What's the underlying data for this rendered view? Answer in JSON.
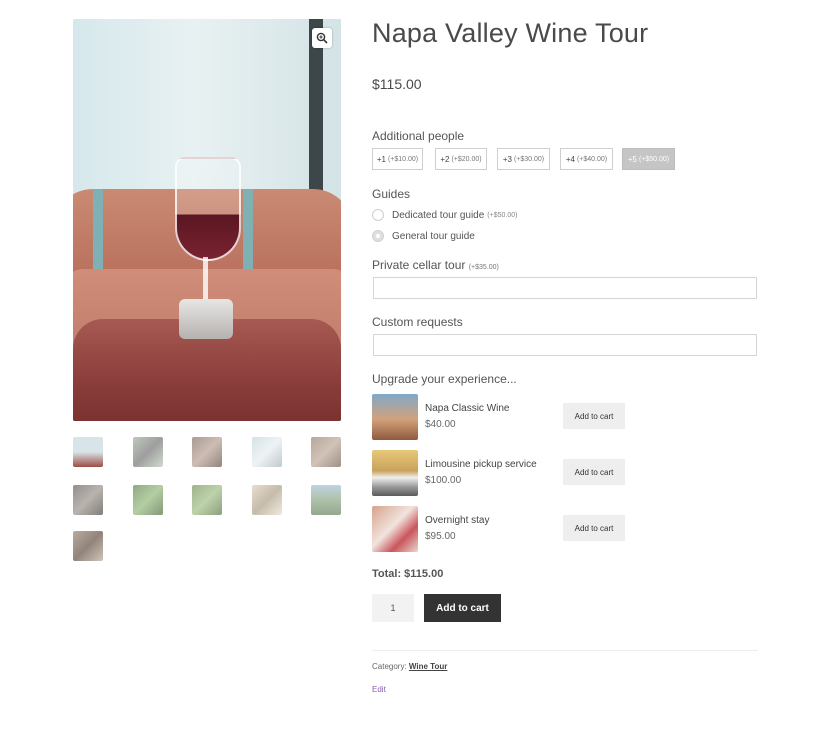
{
  "product": {
    "title": "Napa Valley Wine Tour",
    "price": "$115.00"
  },
  "additional_people": {
    "label": "Additional people",
    "options": [
      {
        "label": "+1",
        "extra": "(+$10.00)",
        "selected": false
      },
      {
        "label": "+2",
        "extra": "(+$20.00)",
        "selected": false
      },
      {
        "label": "+3",
        "extra": "(+$30.00)",
        "selected": false
      },
      {
        "label": "+4",
        "extra": "(+$40.00)",
        "selected": false
      },
      {
        "label": "+5",
        "extra": "(+$50.00)",
        "selected": true
      }
    ]
  },
  "guides": {
    "label": "Guides",
    "options": [
      {
        "label": "Dedicated tour guide",
        "extra": "(+$50.00)",
        "selected": false
      },
      {
        "label": "General tour guide",
        "extra": "",
        "selected": true
      }
    ]
  },
  "private_cellar": {
    "label": "Private cellar tour",
    "extra": "(+$35.00)",
    "value": ""
  },
  "custom_requests": {
    "label": "Custom requests",
    "value": ""
  },
  "upgrade": {
    "label": "Upgrade your experience...",
    "items": [
      {
        "name": "Napa Classic Wine",
        "price": "$40.00",
        "button": "Add to cart"
      },
      {
        "name": "Limousine pickup service",
        "price": "$100.00",
        "button": "Add to cart"
      },
      {
        "name": "Overnight stay",
        "price": "$95.00",
        "button": "Add to cart"
      }
    ]
  },
  "total": "Total: $115.00",
  "quantity": "1",
  "add_to_cart": "Add to cart",
  "meta": {
    "category_label": "Category:",
    "category": "Wine Tour",
    "edit": "Edit"
  },
  "icons": {
    "zoom": "zoom-in-icon"
  }
}
